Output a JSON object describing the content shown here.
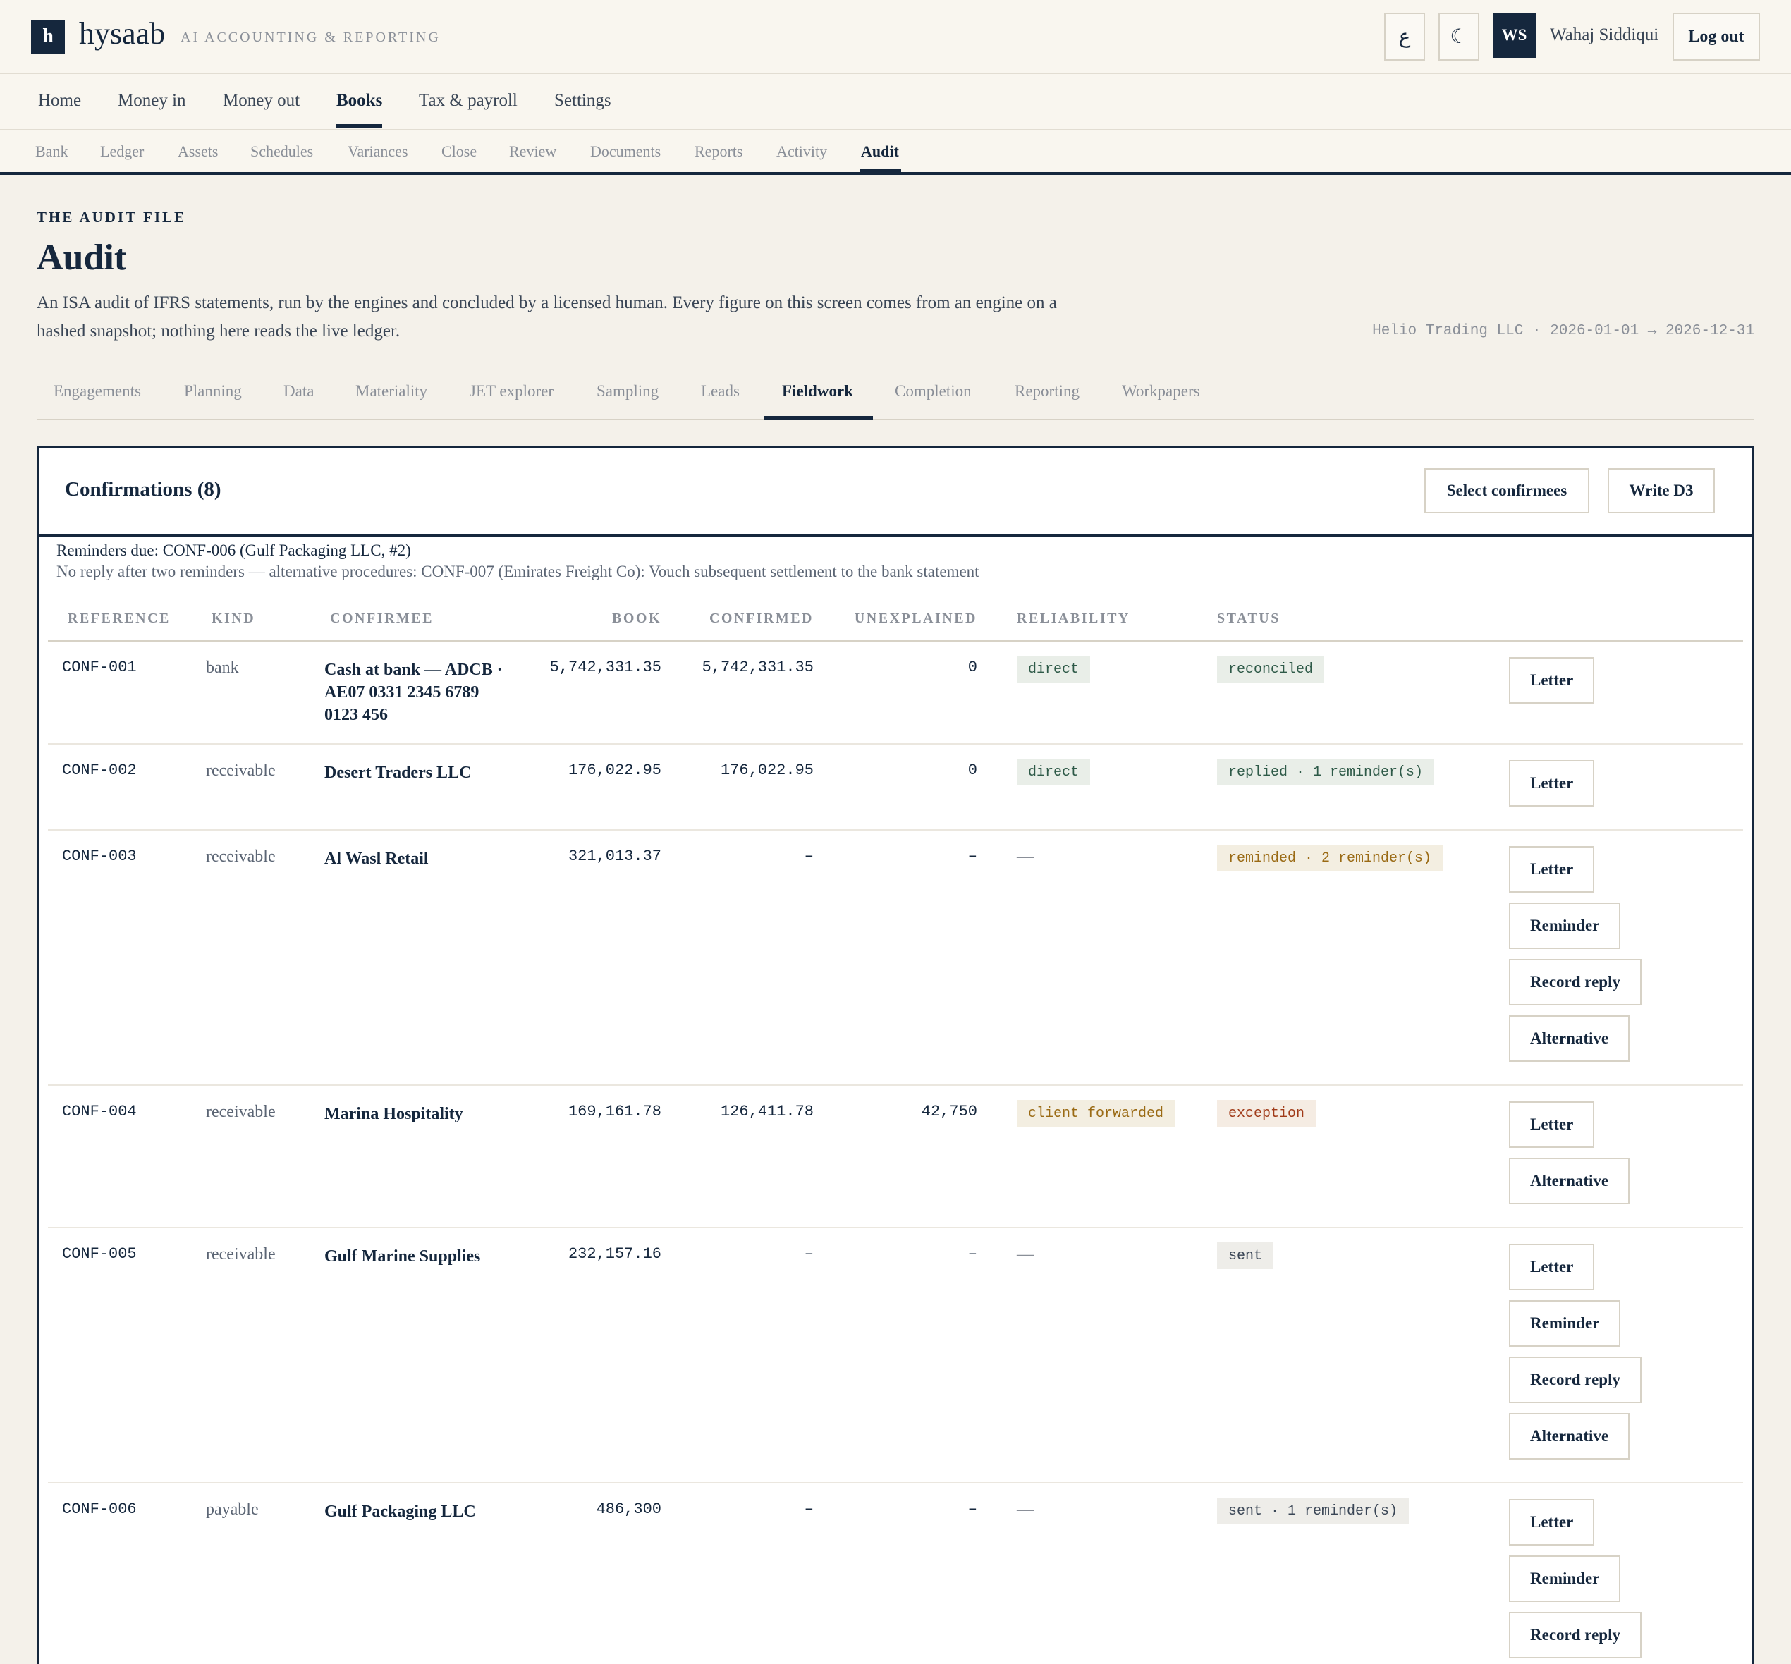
{
  "brand": {
    "logo_letter": "h",
    "name": "hysaab",
    "tagline": "AI ACCOUNTING & REPORTING"
  },
  "header": {
    "lang_toggle": "ع",
    "theme_toggle": "☾",
    "avatar_initials": "WS",
    "user_name": "Wahaj Siddiqui",
    "logout_label": "Log out"
  },
  "main_nav": [
    "Home",
    "Money in",
    "Money out",
    "Books",
    "Tax & payroll",
    "Settings"
  ],
  "main_nav_active": "Books",
  "sub_nav": [
    "Bank",
    "Ledger",
    "Assets",
    "Schedules",
    "Variances",
    "Close",
    "Review",
    "Documents",
    "Reports",
    "Activity",
    "Audit"
  ],
  "sub_nav_active": "Audit",
  "page": {
    "eyebrow": "THE AUDIT FILE",
    "title": "Audit",
    "description": "An ISA audit of IFRS statements, run by the engines and concluded by a licensed human. Every figure on this screen comes from an engine on a hashed snapshot; nothing here reads the live ledger.",
    "entity": "Helio Trading LLC · 2026-01-01 → 2026-12-31"
  },
  "audit_tabs": [
    "Engagements",
    "Planning",
    "Data",
    "Materiality",
    "JET explorer",
    "Sampling",
    "Leads",
    "Fieldwork",
    "Completion",
    "Reporting",
    "Workpapers"
  ],
  "audit_tab_active": "Fieldwork",
  "confirmations": {
    "title": "Confirmations (8)",
    "select_btn": "Select confirmees",
    "write_btn": "Write D3",
    "reminders_due": "Reminders due: CONF-006 (Gulf Packaging LLC, #2)",
    "no_reply": "No reply after two reminders — alternative procedures: CONF-007 (Emirates Freight Co): Vouch subsequent settlement to the bank statement",
    "columns": {
      "reference": "REFERENCE",
      "kind": "KIND",
      "confirmee": "CONFIRMEE",
      "book": "BOOK",
      "confirmed": "CONFIRMED",
      "unexplained": "UNEXPLAINED",
      "reliability": "RELIABILITY",
      "status": "STATUS"
    },
    "rows": [
      {
        "ref": "CONF-001",
        "kind": "bank",
        "confirmee": "Cash at bank — ADCB · AE07 0331 2345 6789 0123 456",
        "book": "5,742,331.35",
        "confirmed": "5,742,331.35",
        "unexplained": "0",
        "reliability": "direct",
        "status": "reconciled",
        "actions": [
          "Letter"
        ]
      },
      {
        "ref": "CONF-002",
        "kind": "receivable",
        "confirmee": "Desert Traders LLC",
        "book": "176,022.95",
        "confirmed": "176,022.95",
        "unexplained": "0",
        "reliability": "direct",
        "status": "replied · 1 reminder(s)",
        "actions": [
          "Letter"
        ]
      },
      {
        "ref": "CONF-003",
        "kind": "receivable",
        "confirmee": "Al Wasl Retail",
        "book": "321,013.37",
        "confirmed": "–",
        "unexplained": "–",
        "reliability": "—",
        "status": "reminded · 2 reminder(s)",
        "actions": [
          "Letter",
          "Reminder",
          "Record reply",
          "Alternative"
        ]
      },
      {
        "ref": "CONF-004",
        "kind": "receivable",
        "confirmee": "Marina Hospitality",
        "book": "169,161.78",
        "confirmed": "126,411.78",
        "unexplained": "42,750",
        "reliability": "client forwarded",
        "status": "exception",
        "actions": [
          "Letter",
          "Alternative"
        ]
      },
      {
        "ref": "CONF-005",
        "kind": "receivable",
        "confirmee": "Gulf Marine Supplies",
        "book": "232,157.16",
        "confirmed": "–",
        "unexplained": "–",
        "reliability": "—",
        "status": "sent",
        "actions": [
          "Letter",
          "Reminder",
          "Record reply",
          "Alternative"
        ]
      },
      {
        "ref": "CONF-006",
        "kind": "payable",
        "confirmee": "Gulf Packaging LLC",
        "book": "486,300",
        "confirmed": "–",
        "unexplained": "–",
        "reliability": "—",
        "status": "sent · 1 reminder(s)",
        "actions": [
          "Letter",
          "Reminder",
          "Record reply"
        ]
      }
    ]
  },
  "colors": {
    "navy": "#15273d",
    "muted": "#8a8f98",
    "background": "#f4f1ea"
  }
}
